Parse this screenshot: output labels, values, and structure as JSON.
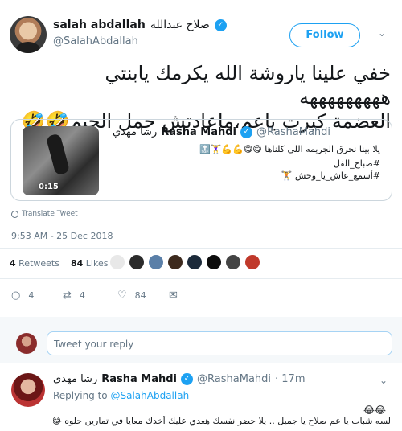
{
  "author": {
    "name": "salah abdallah",
    "name_ar": "صلاح عبدالله",
    "handle": "@SalahAbdallah",
    "follow_label": "Follow"
  },
  "tweet": {
    "text_line1": "خفي علينا ياروشة الله يكرمك يابنتي هههههههههه",
    "text_line2": "العضمة كبرت ياعم،ماعادتش حمل الچيم🤣🤣"
  },
  "quote": {
    "name_ar": "رشا مهدي",
    "name": "Rasha Mahdi",
    "handle": "@RashaMahdi",
    "line1": "يلا بينا نحرق الجريمه اللي كلناها 😋😋💪💪🏋️‍♀️🔝",
    "line2": "#صباح_الفل",
    "line3": "#أسمع_عاش_يا_وحش 🏋️",
    "duration": "0:15"
  },
  "translate_label": "Translate Tweet",
  "timestamp": "9:53 AM - 25 Dec 2018",
  "stats": {
    "retweets_count": "4",
    "retweets_label": "Retweets",
    "likes_count": "84",
    "likes_label": "Likes"
  },
  "actions": {
    "replies": "4",
    "retweets": "4",
    "likes": "84"
  },
  "reply_box": {
    "placeholder": "Tweet your reply"
  },
  "reply": {
    "name_ar": "رشا مهدي",
    "name": "Rasha Mahdi",
    "handle": "@RashaMahdi",
    "time": "· 17m",
    "replying_label": "Replying to",
    "replying_to": "@SalahAbdallah",
    "emoji_line": "😂😂",
    "text": "لسه شباب يا عم صلاح يا جميل .. يلا حضر نفسك هعدي عليك أخدك معايا في تمارين حلوه 😂💪❤️"
  },
  "colors": {
    "accent": "#1da1f2",
    "muted": "#657786",
    "border": "#e6ecf0"
  }
}
